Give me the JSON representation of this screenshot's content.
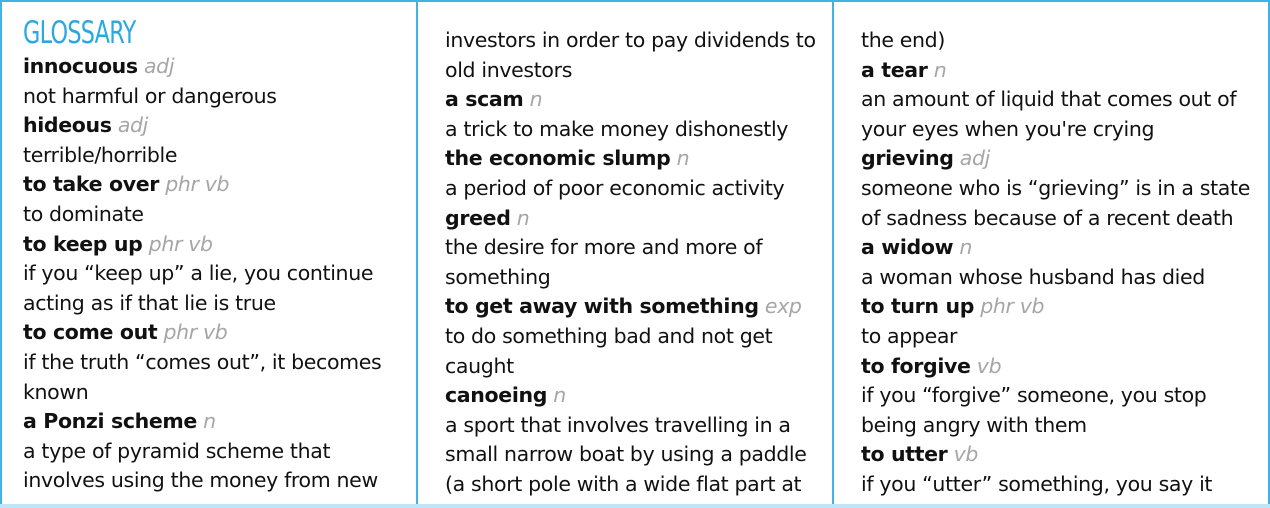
{
  "title": "GLOSSARY",
  "columns": [
    {
      "lines": [
        {
          "kind": "entry",
          "term": "innocuous",
          "pos": "adj"
        },
        {
          "kind": "text",
          "text": "not harmful or dangerous"
        },
        {
          "kind": "entry",
          "term": "hideous",
          "pos": "adj"
        },
        {
          "kind": "text",
          "text": "terrible/horrible"
        },
        {
          "kind": "entry",
          "term": "to take over",
          "pos": "phr vb"
        },
        {
          "kind": "text",
          "text": "to dominate"
        },
        {
          "kind": "entry",
          "term": "to keep up",
          "pos": "phr vb"
        },
        {
          "kind": "text",
          "text": "if you “keep up” a lie, you continue"
        },
        {
          "kind": "text",
          "text": "acting as if that lie is true"
        },
        {
          "kind": "entry",
          "term": "to come out",
          "pos": "phr vb"
        },
        {
          "kind": "text",
          "text": "if the truth “comes out”, it becomes"
        },
        {
          "kind": "text",
          "text": "known"
        },
        {
          "kind": "entry",
          "term": "a Ponzi scheme",
          "pos": "n"
        },
        {
          "kind": "text",
          "text": "a type of pyramid scheme that"
        },
        {
          "kind": "text",
          "text": "involves using the money from new"
        }
      ]
    },
    {
      "lines": [
        {
          "kind": "text",
          "text": "investors in order to pay dividends to"
        },
        {
          "kind": "text",
          "text": "old investors"
        },
        {
          "kind": "entry",
          "term": "a scam",
          "pos": "n"
        },
        {
          "kind": "text",
          "text": "a trick to make money dishonestly"
        },
        {
          "kind": "entry",
          "term": "the economic slump",
          "pos": "n"
        },
        {
          "kind": "text",
          "text": "a period of poor economic activity"
        },
        {
          "kind": "entry",
          "term": "greed",
          "pos": "n"
        },
        {
          "kind": "text",
          "text": "the desire for more and more of"
        },
        {
          "kind": "text",
          "text": "something"
        },
        {
          "kind": "entry",
          "term": "to get away with something",
          "pos": "exp"
        },
        {
          "kind": "text",
          "text": "to do something bad and not get"
        },
        {
          "kind": "text",
          "text": "caught"
        },
        {
          "kind": "entry",
          "term": "canoeing",
          "pos": "n"
        },
        {
          "kind": "text",
          "text": "a sport that involves travelling in a"
        },
        {
          "kind": "text",
          "text": "small narrow boat by using a paddle"
        },
        {
          "kind": "text",
          "text": "(a short pole with a wide flat part at"
        }
      ]
    },
    {
      "lines": [
        {
          "kind": "text",
          "text": "the end)"
        },
        {
          "kind": "entry",
          "term": "a tear",
          "pos": "n"
        },
        {
          "kind": "text",
          "text": "an amount of liquid that comes out of"
        },
        {
          "kind": "text",
          "text": "your eyes when you're crying"
        },
        {
          "kind": "entry",
          "term": "grieving",
          "pos": "adj"
        },
        {
          "kind": "text",
          "text": "someone who is “grieving” is in a state"
        },
        {
          "kind": "text",
          "text": "of sadness because of a recent death"
        },
        {
          "kind": "entry",
          "term": "a widow",
          "pos": "n"
        },
        {
          "kind": "text",
          "text": "a woman whose husband has died"
        },
        {
          "kind": "entry",
          "term": "to turn up",
          "pos": "phr vb"
        },
        {
          "kind": "text",
          "text": "to appear"
        },
        {
          "kind": "entry",
          "term": "to forgive",
          "pos": "vb"
        },
        {
          "kind": "text",
          "text": "if you “forgive” someone, you stop"
        },
        {
          "kind": "text",
          "text": "being angry with them"
        },
        {
          "kind": "entry",
          "term": "to utter",
          "pos": "vb"
        },
        {
          "kind": "text",
          "text": "if you “utter” something, you say it"
        }
      ]
    }
  ],
  "colors": {
    "accent": "#2aa8e0",
    "border": "#3fb3e6",
    "part_of_speech": "#a6a6a6",
    "text": "#111111"
  }
}
